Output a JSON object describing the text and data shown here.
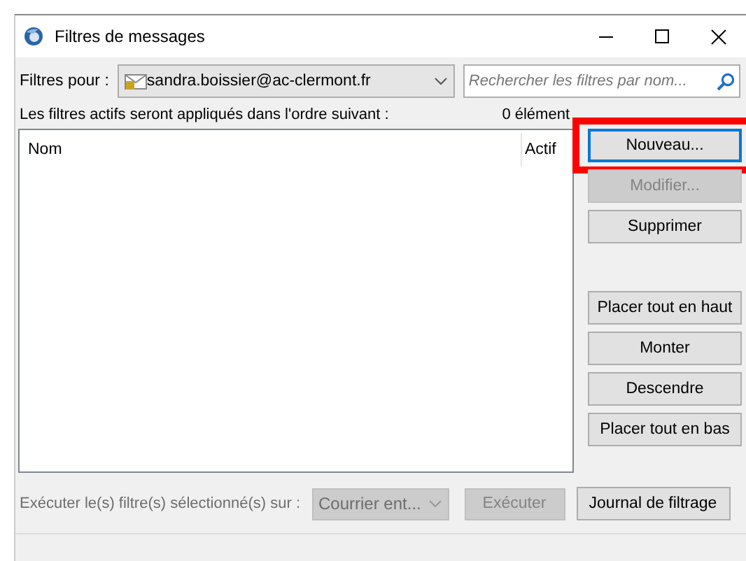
{
  "window": {
    "title": "Filtres de messages"
  },
  "filters_for": {
    "label": "Filtres pour :",
    "account": "sandra.boissier@ac-clermont.fr"
  },
  "search": {
    "placeholder": "Rechercher les filtres par nom..."
  },
  "status": {
    "text": "Les filtres actifs seront appliqués dans l'ordre suivant :",
    "count": "0 élément"
  },
  "table": {
    "columns": [
      "Nom",
      "Actif"
    ]
  },
  "button_groups": [
    [
      {
        "label": "Nouveau...",
        "disabled": false,
        "focused": true,
        "highlighted": true
      },
      {
        "label": "Modifier...",
        "disabled": true,
        "focused": false,
        "highlighted": false
      },
      {
        "label": "Supprimer",
        "disabled": false,
        "focused": false,
        "highlighted": false
      }
    ],
    [
      {
        "label": "Placer tout en haut",
        "disabled": false,
        "focused": false,
        "highlighted": false
      },
      {
        "label": "Monter",
        "disabled": false,
        "focused": false,
        "highlighted": false
      },
      {
        "label": "Descendre",
        "disabled": false,
        "focused": false,
        "highlighted": false
      },
      {
        "label": "Placer tout en bas",
        "disabled": false,
        "focused": false,
        "highlighted": false
      }
    ]
  ],
  "run": {
    "label": "Exécuter le(s) filtre(s) sélectionné(s) sur :",
    "folder": "Courrier ent...",
    "button": "Exécuter",
    "disabled": true
  },
  "log_button": {
    "label": "Journal de filtrage"
  }
}
